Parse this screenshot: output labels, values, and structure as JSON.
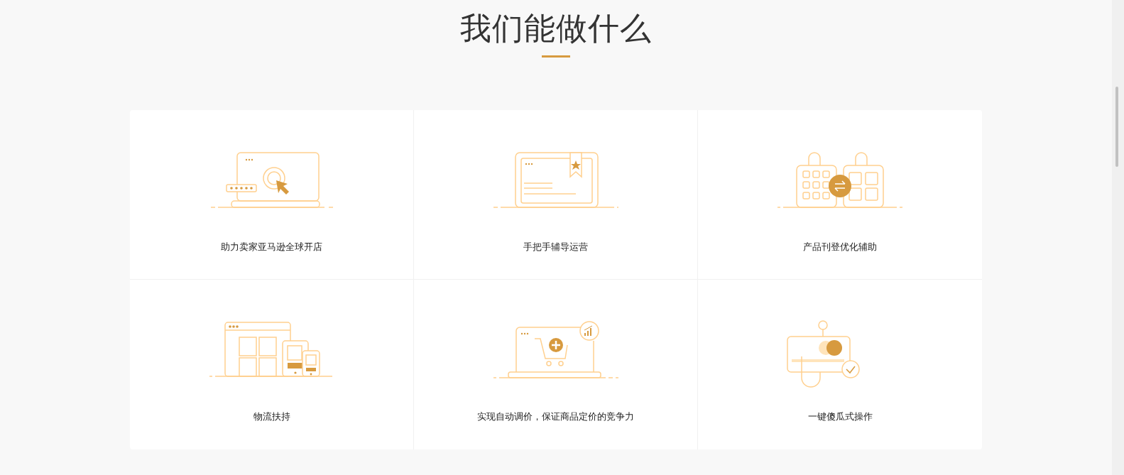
{
  "section": {
    "title": "我们能做什么"
  },
  "features": [
    {
      "kind": "laptop",
      "label": "助力卖家亚马逊全球开店"
    },
    {
      "kind": "tablet",
      "label": "手把手辅导运营"
    },
    {
      "kind": "bags",
      "label": "产品刊登优化辅助"
    },
    {
      "kind": "devices",
      "label": "物流扶持"
    },
    {
      "kind": "cart",
      "label": "实现自动调价，保证商品定价的竞争力"
    },
    {
      "kind": "card",
      "label": "一键傻瓜式操作"
    }
  ]
}
